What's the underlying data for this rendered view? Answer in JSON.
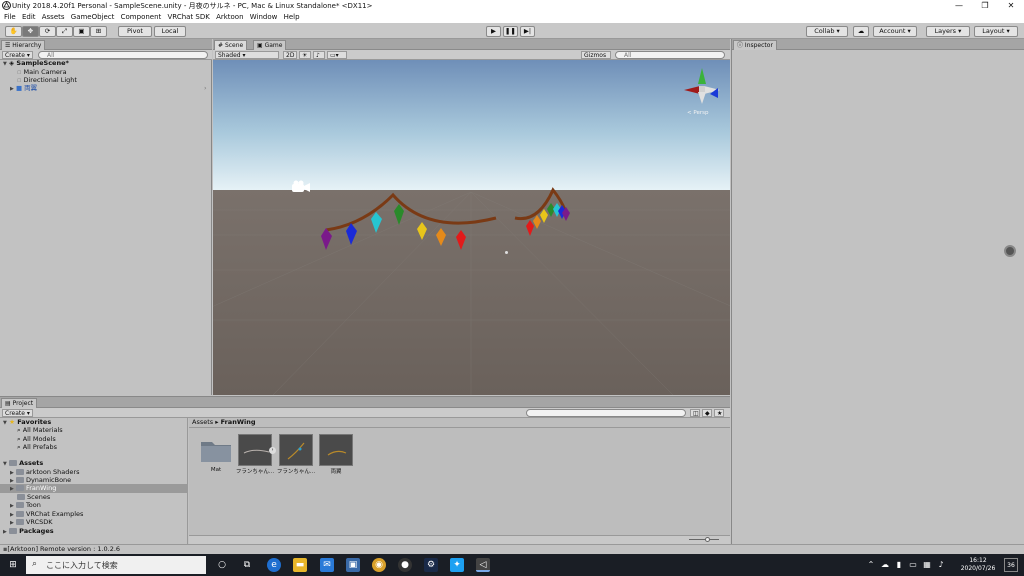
{
  "window": {
    "title": "Unity 2018.4.20f1 Personal - SampleScene.unity - 月夜のサルネ - PC, Mac & Linux Standalone* <DX11>"
  },
  "menu": [
    "File",
    "Edit",
    "Assets",
    "GameObject",
    "Component",
    "VRChat SDK",
    "Arktoon",
    "Window",
    "Help"
  ],
  "toolbar": {
    "pivot": "Pivot",
    "local": "Local",
    "collab": "Collab ▾",
    "account": "Account",
    "layers": "Layers",
    "layout": "Layout"
  },
  "hierarchy": {
    "tab": "Hierarchy",
    "create": "Create ▾",
    "search_placeholder": "All",
    "scene": "SampleScene*",
    "items": [
      "Main Camera",
      "Directional Light",
      "両翼"
    ]
  },
  "scene_view": {
    "tab_scene": "Scene",
    "tab_game": "Game",
    "shading": "Shaded",
    "mode2d": "2D",
    "gizmos": "Gizmos ▾",
    "search_placeholder": "All",
    "persp": "< Persp"
  },
  "inspector": {
    "tab": "Inspector"
  },
  "project": {
    "tab": "Project",
    "create": "Create ▾",
    "favorites_label": "Favorites",
    "favorites": [
      "All Materials",
      "All Models",
      "All Prefabs"
    ],
    "assets_label": "Assets",
    "folders": [
      "arktoon Shaders",
      "DynamicBone",
      "FranWing",
      "Scenes",
      "Toon",
      "VRChat Examples",
      "VRCSDK"
    ],
    "packages_label": "Packages",
    "breadcrumb": [
      "Assets",
      "FranWing"
    ],
    "breadcrumb_sep": "▸",
    "asset_names": [
      "Mat",
      "フランちゃん...",
      "フランちゃん...",
      "両翼"
    ]
  },
  "status": {
    "text": "[Arktoon] Remote version : 1.0.2.6"
  },
  "taskbar": {
    "search": "ここに入力して検索",
    "time": "16:12",
    "date": "2020/07/26",
    "badge": "36"
  }
}
